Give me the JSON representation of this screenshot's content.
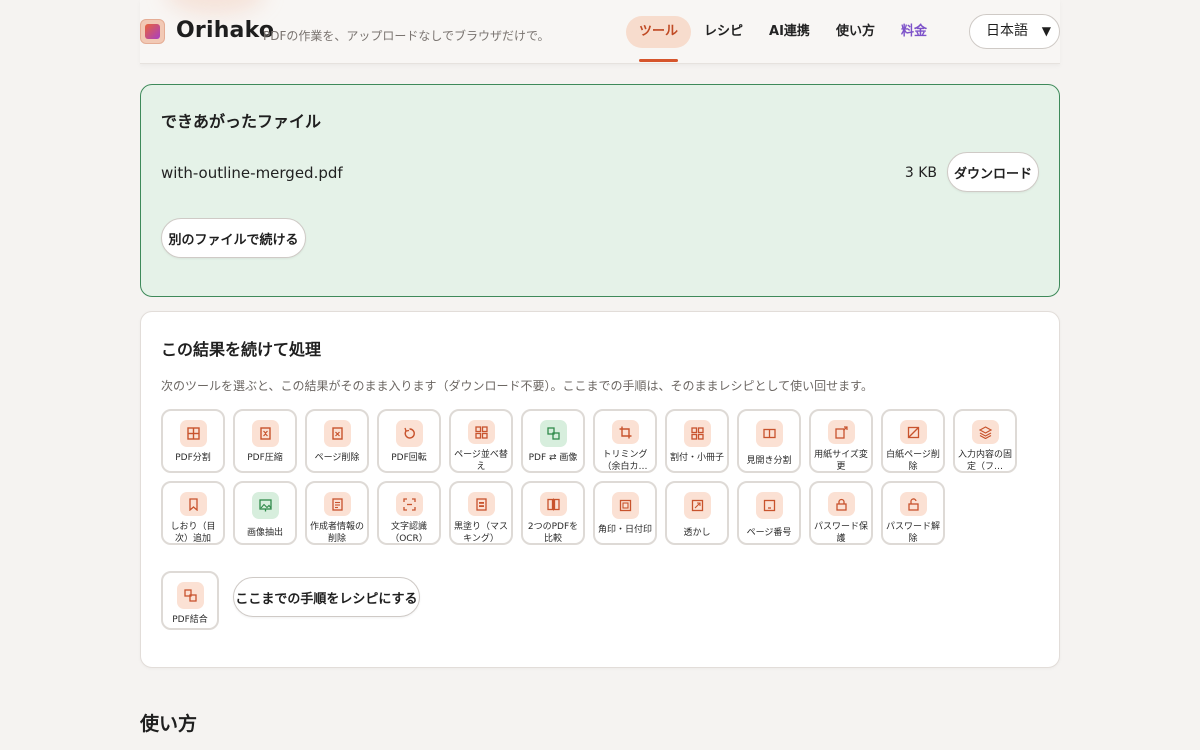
{
  "header": {
    "brand": "Orihako",
    "tagline": "PDFの作業を、アップロードなしでブラウザだけで。",
    "nav": [
      "ツール",
      "レシピ",
      "AI連携",
      "使い方",
      "料金"
    ],
    "active_nav": "ツール",
    "language": "日本語"
  },
  "result": {
    "title": "できあがったファイル",
    "file_name": "with-outline-merged.pdf",
    "file_size": "3 KB",
    "download_label": "ダウンロード",
    "continue_label": "別のファイルで続ける"
  },
  "chain": {
    "title": "この結果を続けて処理",
    "description": "次のツールを選ぶと、この結果がそのまま入ります（ダウンロード不要）。ここまでの手順は、そのままレシピとして使い回せます。",
    "tools": [
      {
        "label": "PDF分割",
        "icon": "split-icon"
      },
      {
        "label": "PDF圧縮",
        "icon": "compress-icon"
      },
      {
        "label": "ページ削除",
        "icon": "delete-page-icon"
      },
      {
        "label": "PDF回転",
        "icon": "rotate-icon"
      },
      {
        "label": "ページ並べ替え",
        "icon": "reorder-icon"
      },
      {
        "label": "PDF ⇄ 画像",
        "icon": "pdf-image-convert-icon"
      },
      {
        "label": "トリミング（余白カ…",
        "icon": "crop-icon"
      },
      {
        "label": "割付・小冊子",
        "icon": "imposition-icon"
      },
      {
        "label": "見開き分割",
        "icon": "spread-split-icon"
      },
      {
        "label": "用紙サイズ変更",
        "icon": "resize-icon"
      },
      {
        "label": "白紙ページ削除",
        "icon": "blank-page-remove-icon"
      },
      {
        "label": "入力内容の固定（フ…",
        "icon": "flatten-layers-icon"
      },
      {
        "label": "しおり（目次）追加",
        "icon": "bookmark-icon"
      },
      {
        "label": "画像抽出",
        "icon": "image-extract-icon"
      },
      {
        "label": "作成者情報の削除",
        "icon": "metadata-remove-icon"
      },
      {
        "label": "文字認識（OCR）",
        "icon": "ocr-icon"
      },
      {
        "label": "黒塗り（マスキング）",
        "icon": "redact-icon"
      },
      {
        "label": "2つのPDFを比較",
        "icon": "compare-icon"
      },
      {
        "label": "角印・日付印",
        "icon": "stamp-icon"
      },
      {
        "label": "透かし",
        "icon": "watermark-icon"
      },
      {
        "label": "ページ番号",
        "icon": "page-number-icon"
      },
      {
        "label": "パスワード保護",
        "icon": "lock-icon"
      },
      {
        "label": "パスワード解除",
        "icon": "unlock-icon"
      }
    ],
    "merge_tool": {
      "label": "PDF結合",
      "icon": "merge-icon"
    },
    "recipe_label": "ここまでの手順をレシピにする"
  },
  "howto": {
    "title": "使い方"
  }
}
